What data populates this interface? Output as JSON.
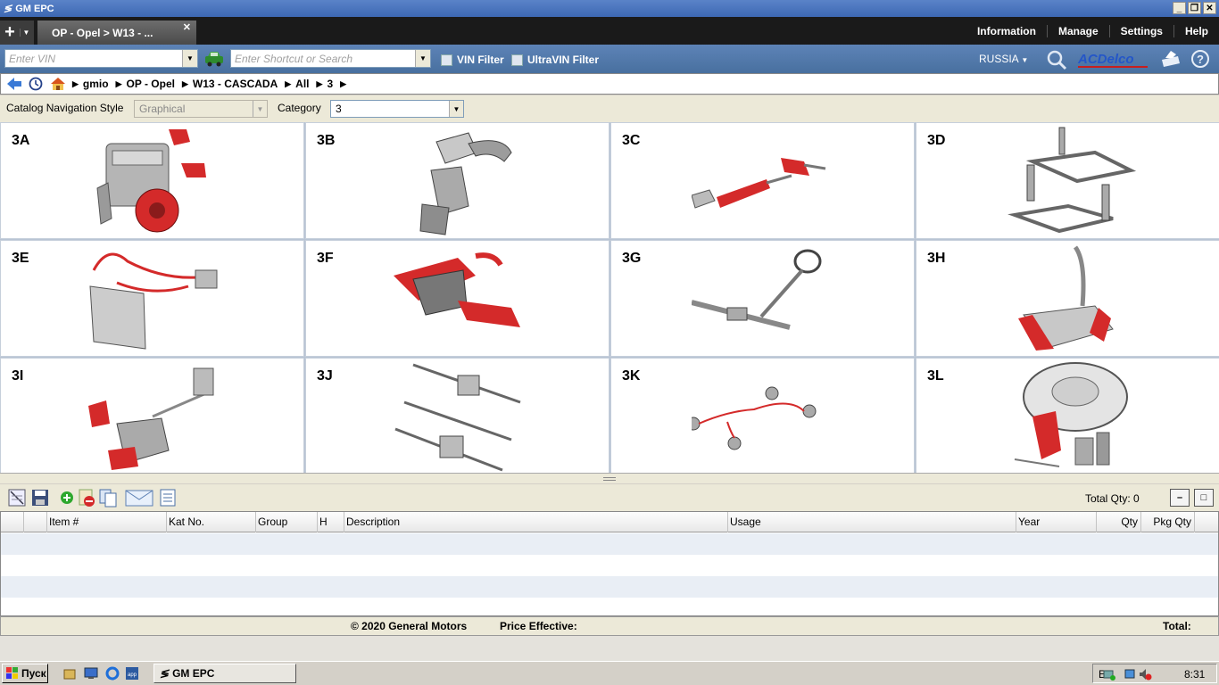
{
  "window": {
    "title": "GM EPC"
  },
  "tabbar": {
    "active_tab": "OP - Opel > W13 - ...",
    "menu": [
      "Information",
      "Manage",
      "Settings",
      "Help"
    ]
  },
  "toolbar": {
    "vin_placeholder": "Enter VIN",
    "search_placeholder": "Enter Shortcut or Search",
    "vin_filter": "VIN Filter",
    "ultravin_filter": "UltraVIN Filter",
    "region": "RUSSIA",
    "brand": "ACDelco"
  },
  "breadcrumb": [
    "gmio",
    "OP - Opel",
    "W13 - CASCADA",
    "All",
    "3"
  ],
  "nav": {
    "style_label": "Catalog Navigation Style",
    "style_value": "Graphical",
    "category_label": "Category",
    "category_value": "3"
  },
  "categories": [
    "3A",
    "3B",
    "3C",
    "3D",
    "3E",
    "3F",
    "3G",
    "3H",
    "3I",
    "3J",
    "3K",
    "3L"
  ],
  "parts": {
    "total_qty": "Total Qty: 0",
    "columns": [
      "Item #",
      "Kat No.",
      "Group",
      "H",
      "Description",
      "Usage",
      "Year",
      "Qty",
      "Pkg Qty"
    ]
  },
  "footer": {
    "copyright": "© 2020 General Motors",
    "price_effective": "Price Effective:",
    "total": "Total:"
  },
  "taskbar": {
    "start": "Пуск",
    "task": "GM EPC",
    "lang": "EN",
    "clock": "8:31"
  }
}
